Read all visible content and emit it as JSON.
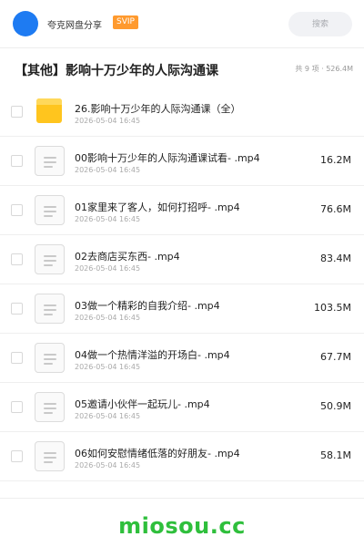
{
  "header": {
    "title": "夸克网盘分享",
    "badge": "SVIP",
    "search_placeholder": "搜索"
  },
  "folder": {
    "title": "【其他】影响十万少年的人际沟通课",
    "summary": "共 9 项 · 526.4M"
  },
  "items": [
    {
      "name": "26.影响十万少年的人际沟通课（全）",
      "date": "2026-05-04 16:45",
      "size": "",
      "type": "folder"
    },
    {
      "name": "00影响十万少年的人际沟通课试看- .mp4",
      "date": "2026-05-04 16:45",
      "size": "16.2M",
      "type": "file"
    },
    {
      "name": "01家里来了客人，如何打招呼- .mp4",
      "date": "2026-05-04 16:45",
      "size": "76.6M",
      "type": "file"
    },
    {
      "name": "02去商店买东西- .mp4",
      "date": "2026-05-04 16:45",
      "size": "83.4M",
      "type": "file"
    },
    {
      "name": "03做一个精彩的自我介绍- .mp4",
      "date": "2026-05-04 16:45",
      "size": "103.5M",
      "type": "file"
    },
    {
      "name": "04做一个热情洋溢的开场白- .mp4",
      "date": "2026-05-04 16:45",
      "size": "67.7M",
      "type": "file"
    },
    {
      "name": "05邀请小伙伴一起玩儿- .mp4",
      "date": "2026-05-04 16:45",
      "size": "50.9M",
      "type": "file"
    },
    {
      "name": "06如何安慰情绪低落的好朋友- .mp4",
      "date": "2026-05-04 16:45",
      "size": "58.1M",
      "type": "file"
    }
  ],
  "footer": {
    "brand": "miosou.cc"
  },
  "colors": {
    "avatar": "#1e7bf2",
    "svip": "#ff9a2e",
    "folder": "#ffc51e",
    "brand": "#2fbf3c"
  }
}
